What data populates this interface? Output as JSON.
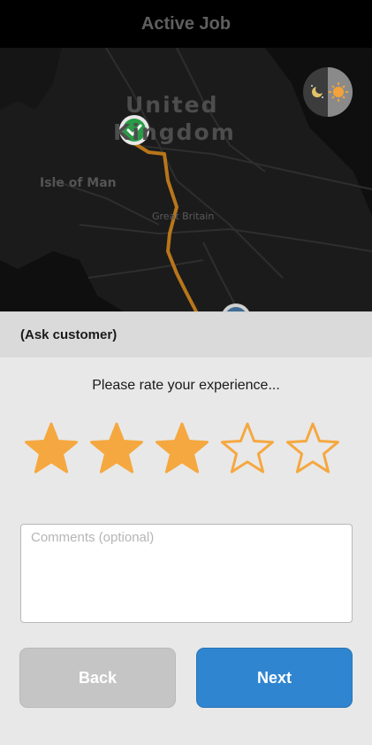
{
  "header": {
    "title": "Active Job"
  },
  "map": {
    "labels": {
      "country_line1": "United",
      "country_line2": "Kingdom",
      "isle_of_man": "Isle of Man",
      "great_britain": "Great Britain"
    },
    "route_color": "#c57f1a",
    "start_marker": "checkmark-icon",
    "theme_toggle_icons": [
      "moon-icon",
      "sun-icon"
    ]
  },
  "panel": {
    "header": "(Ask customer)",
    "prompt": "Please rate your experience...",
    "rating": {
      "value": 3,
      "max": 5,
      "color": "#f5a840"
    },
    "comments": {
      "placeholder": "Comments (optional)",
      "value": ""
    },
    "buttons": {
      "back": "Back",
      "next": "Next"
    }
  }
}
